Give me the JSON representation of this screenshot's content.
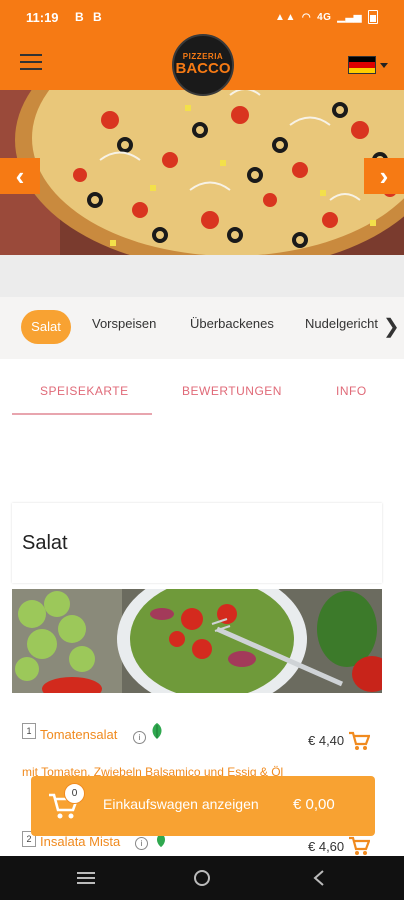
{
  "statusbar": {
    "time": "11:19",
    "notif_icons": [
      "B",
      "B"
    ],
    "network": "4G",
    "icons": [
      "hd-voice-icon",
      "wifi-call-icon",
      "signal-icon",
      "battery-icon"
    ]
  },
  "appbar": {
    "logo_line1": "PIZZERIA",
    "logo_line2": "BACCO",
    "language": "Deutsch",
    "flag_colors": [
      "#000000",
      "#dd0000",
      "#ffce00"
    ],
    "accent": "#f67a14"
  },
  "categories": {
    "active": "Salat",
    "items": [
      "Vorspeisen",
      "Überbackenes",
      "Nudelgericht"
    ]
  },
  "tabs": [
    "SPEISEKARTE",
    "BEWERTUNGEN",
    "INFO"
  ],
  "section": {
    "title": "Salat"
  },
  "menu_items": [
    {
      "num": "1",
      "name": "Tomatensalat",
      "price": "€ 4,40",
      "desc": "mit Tomaten, Zwiebeln Balsamico und Essig & Öl"
    },
    {
      "num": "2",
      "name": "Insalata Mista",
      "price": "€ 4,60"
    }
  ],
  "cart": {
    "count": "0",
    "label": "Einkaufswagen anzeigen",
    "total": "€ 0,00"
  },
  "navbar": {
    "icons": [
      "recent-apps-icon",
      "home-icon",
      "back-icon"
    ]
  }
}
